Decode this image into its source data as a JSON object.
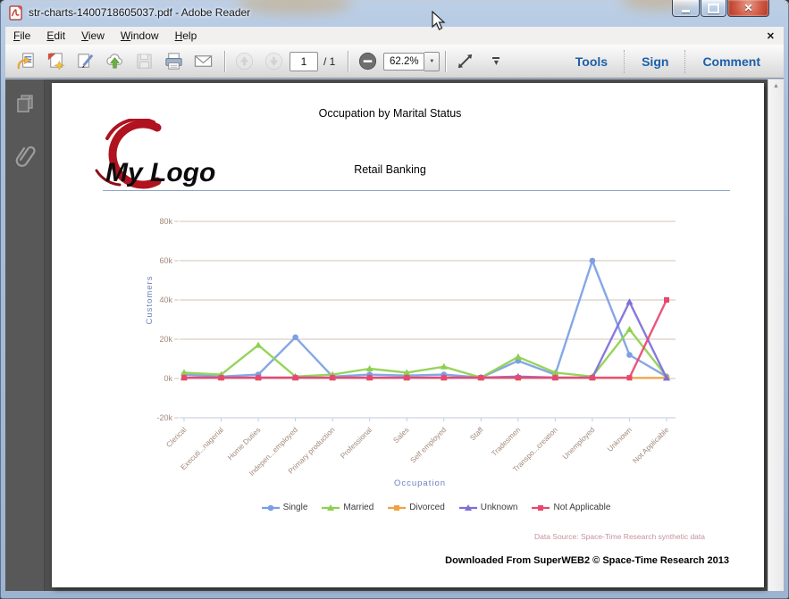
{
  "window": {
    "title": "str-charts-1400718605037.pdf - Adobe Reader"
  },
  "icons": {
    "close": "✕",
    "menu_close": "✕",
    "zoom_dropdown": "▼",
    "overflow": "▾",
    "scroll_up": "▲"
  },
  "menu": {
    "items": [
      "File",
      "Edit",
      "View",
      "Window",
      "Help"
    ]
  },
  "toolbar": {
    "page_value": "1",
    "page_total": "/ 1",
    "zoom_value": "62.2%",
    "tools": "Tools",
    "sign": "Sign",
    "comment": "Comment"
  },
  "page": {
    "title": "Occupation by Marital Status",
    "subtitle": "Retail Banking",
    "logo_text": "My Logo",
    "data_source": "Data Source: Space-Time Research synthetic data",
    "footer": "Downloaded From SuperWEB2 © Space-Time Research 2013"
  },
  "chart_data": {
    "type": "line",
    "title": "Occupation by Marital Status",
    "xlabel": "Occupation",
    "ylabel": "Customers",
    "ylim": [
      -20000,
      80000
    ],
    "yticks": [
      80000,
      60000,
      40000,
      20000,
      0,
      -20000
    ],
    "ytick_labels": [
      "80k",
      "60k",
      "40k",
      "20k",
      "0k",
      "-20k"
    ],
    "grid": true,
    "legend_position": "bottom",
    "categories": [
      "Clerical",
      "Executi...nagerial",
      "Home Duties",
      "Indepen...employed",
      "Primary production",
      "Professional",
      "Sales",
      "Self employed",
      "Staff",
      "Tradesmen",
      "Transpo...creation",
      "Unemployed",
      "Unknown",
      "Not Applicable"
    ],
    "series": [
      {
        "name": "Single",
        "color": "#7c9fe3",
        "marker": "circle",
        "values": [
          2000,
          1000,
          2000,
          21000,
          1000,
          2000,
          1500,
          2000,
          500,
          9000,
          2000,
          60000,
          12000,
          1000
        ]
      },
      {
        "name": "Married",
        "color": "#8ed04e",
        "marker": "triangle",
        "values": [
          3000,
          2000,
          17000,
          1000,
          2000,
          5000,
          3000,
          6000,
          500,
          11000,
          3000,
          1000,
          25000,
          1000
        ]
      },
      {
        "name": "Divorced",
        "color": "#f0a143",
        "marker": "square",
        "values": [
          300,
          300,
          300,
          300,
          300,
          300,
          300,
          300,
          300,
          300,
          300,
          300,
          300,
          300
        ]
      },
      {
        "name": "Unknown",
        "color": "#7f6ed9",
        "marker": "triangle",
        "values": [
          500,
          500,
          500,
          500,
          500,
          500,
          500,
          500,
          500,
          1000,
          500,
          500,
          39000,
          300
        ]
      },
      {
        "name": "Not Applicable",
        "color": "#e8486e",
        "marker": "square",
        "values": [
          400,
          400,
          400,
          400,
          400,
          400,
          400,
          400,
          400,
          400,
          400,
          400,
          400,
          40000
        ]
      }
    ]
  }
}
